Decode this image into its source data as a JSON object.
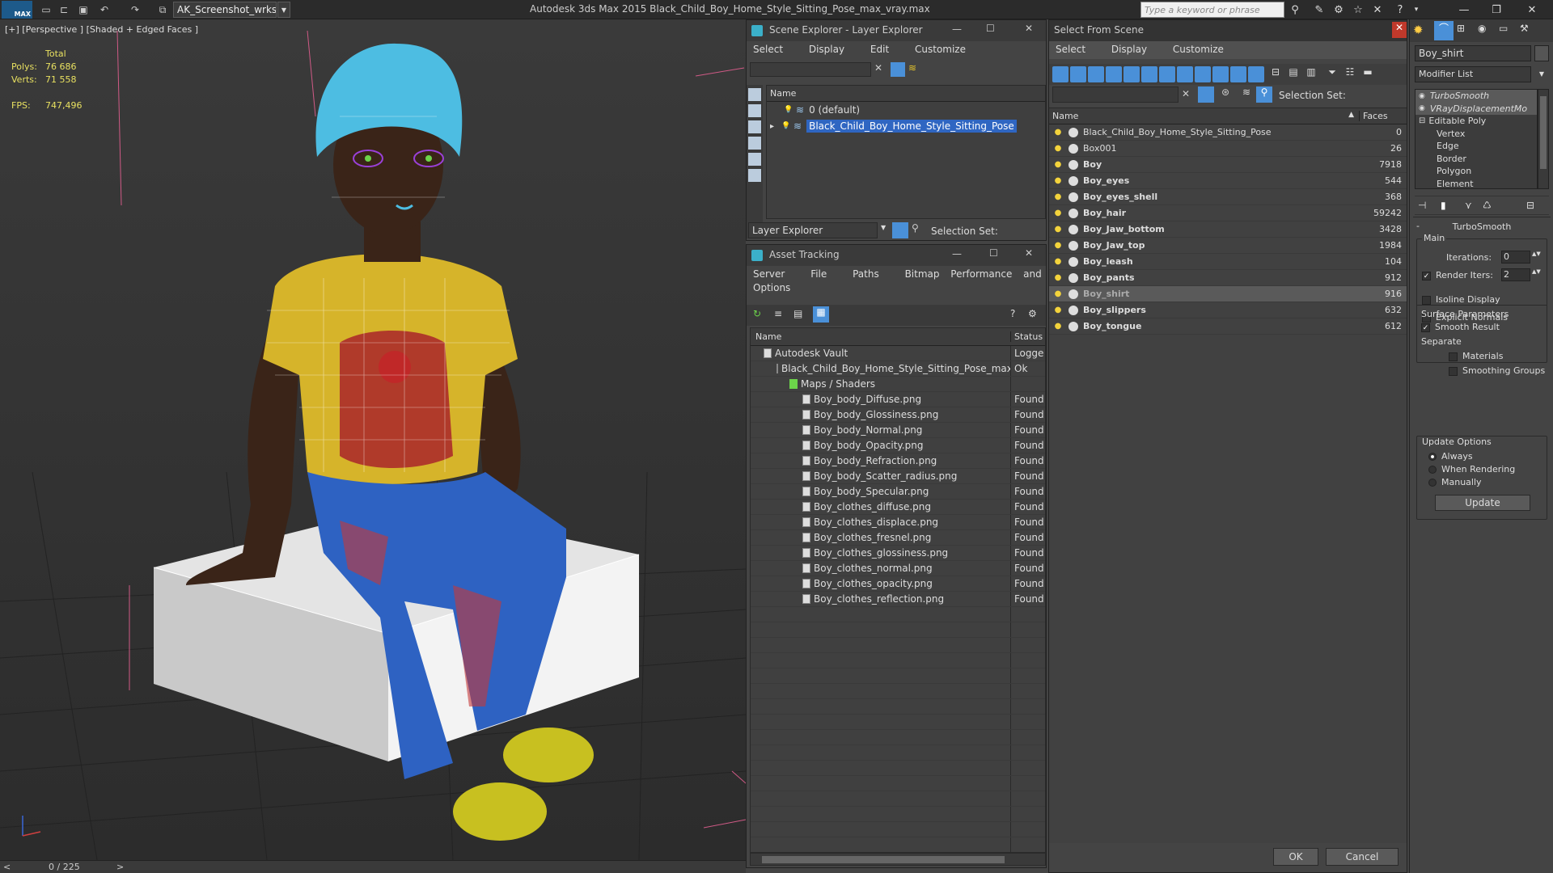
{
  "app": {
    "logo": "MAX",
    "workspace": "AK_Screenshot_wrksp",
    "title": "Autodesk 3ds Max  2015    Black_Child_Boy_Home_Style_Sitting_Pose_max_vray.max",
    "search_placeholder": "Type a keyword or phrase"
  },
  "viewport": {
    "label": "[+] [Perspective ] [Shaded + Edged Faces ]",
    "stats": {
      "total_label": "Total",
      "polys_label": "Polys:",
      "polys_value": "76 686",
      "verts_label": "Verts:",
      "verts_value": "71 558",
      "fps_label": "FPS:",
      "fps_value": "747,496"
    },
    "timebar": "0 / 225",
    "timebar_prev": "<",
    "timebar_next": ">"
  },
  "scene_explorer": {
    "title": "Scene Explorer - Layer Explorer",
    "menu": [
      "Select",
      "Display",
      "Edit",
      "Customize"
    ],
    "column_name": "Name",
    "layers": [
      {
        "name": "0 (default)",
        "selected": false
      },
      {
        "name": "Black_Child_Boy_Home_Style_Sitting_Pose",
        "selected": true
      }
    ],
    "footer_dropdown": "Layer Explorer",
    "selection_set_label": "Selection Set:"
  },
  "asset_tracking": {
    "title": "Asset Tracking",
    "menu": [
      "Server",
      "File",
      "Paths",
      "Bitmap Performance and Memory"
    ],
    "menu2": "Options",
    "col_name": "Name",
    "col_status": "Status",
    "rows": [
      {
        "name": "Autodesk Vault",
        "status": "Logge",
        "indent": 1
      },
      {
        "name": "Black_Child_Boy_Home_Style_Sitting_Pose_max_...",
        "status": "Ok",
        "indent": 2
      },
      {
        "name": "Maps / Shaders",
        "status": "",
        "indent": 3
      },
      {
        "name": "Boy_body_Diffuse.png",
        "status": "Found",
        "indent": 4
      },
      {
        "name": "Boy_body_Glossiness.png",
        "status": "Found",
        "indent": 4
      },
      {
        "name": "Boy_body_Normal.png",
        "status": "Found",
        "indent": 4
      },
      {
        "name": "Boy_body_Opacity.png",
        "status": "Found",
        "indent": 4
      },
      {
        "name": "Boy_body_Refraction.png",
        "status": "Found",
        "indent": 4
      },
      {
        "name": "Boy_body_Scatter_radius.png",
        "status": "Found",
        "indent": 4
      },
      {
        "name": "Boy_body_Specular.png",
        "status": "Found",
        "indent": 4
      },
      {
        "name": "Boy_clothes_diffuse.png",
        "status": "Found",
        "indent": 4
      },
      {
        "name": "Boy_clothes_displace.png",
        "status": "Found",
        "indent": 4
      },
      {
        "name": "Boy_clothes_fresnel.png",
        "status": "Found",
        "indent": 4
      },
      {
        "name": "Boy_clothes_glossiness.png",
        "status": "Found",
        "indent": 4
      },
      {
        "name": "Boy_clothes_normal.png",
        "status": "Found",
        "indent": 4
      },
      {
        "name": "Boy_clothes_opacity.png",
        "status": "Found",
        "indent": 4
      },
      {
        "name": "Boy_clothes_reflection.png",
        "status": "Found",
        "indent": 4
      }
    ]
  },
  "select_from_scene": {
    "title": "Select From Scene",
    "menu": [
      "Select",
      "Display",
      "Customize"
    ],
    "selection_set_label": "Selection Set:",
    "col_name": "Name",
    "col_faces": "Faces",
    "objects": [
      {
        "name": "Black_Child_Boy_Home_Style_Sitting_Pose",
        "faces": "0",
        "bold": false,
        "selected": false
      },
      {
        "name": "Box001",
        "faces": "26",
        "bold": false,
        "selected": false
      },
      {
        "name": "Boy",
        "faces": "7918",
        "bold": true,
        "selected": false
      },
      {
        "name": "Boy_eyes",
        "faces": "544",
        "bold": true,
        "selected": false
      },
      {
        "name": "Boy_eyes_shell",
        "faces": "368",
        "bold": true,
        "selected": false
      },
      {
        "name": "Boy_hair",
        "faces": "59242",
        "bold": true,
        "selected": false
      },
      {
        "name": "Boy_Jaw_bottom",
        "faces": "3428",
        "bold": true,
        "selected": false
      },
      {
        "name": "Boy_Jaw_top",
        "faces": "1984",
        "bold": true,
        "selected": false
      },
      {
        "name": "Boy_leash",
        "faces": "104",
        "bold": true,
        "selected": false
      },
      {
        "name": "Boy_pants",
        "faces": "912",
        "bold": true,
        "selected": false
      },
      {
        "name": "Boy_shirt",
        "faces": "916",
        "bold": true,
        "selected": true
      },
      {
        "name": "Boy_slippers",
        "faces": "632",
        "bold": true,
        "selected": false
      },
      {
        "name": "Boy_tongue",
        "faces": "612",
        "bold": true,
        "selected": false
      }
    ],
    "ok": "OK",
    "cancel": "Cancel"
  },
  "modify_panel": {
    "object_name": "Boy_shirt",
    "modifier_list": "Modifier List",
    "stack": [
      {
        "name": "TurboSmooth",
        "italic": true,
        "indent": 0
      },
      {
        "name": "VRayDisplacementMo",
        "italic": true,
        "indent": 0
      },
      {
        "name": "Editable Poly",
        "italic": false,
        "indent": 0
      },
      {
        "name": "Vertex",
        "italic": false,
        "indent": 1
      },
      {
        "name": "Edge",
        "italic": false,
        "indent": 1
      },
      {
        "name": "Border",
        "italic": false,
        "indent": 1
      },
      {
        "name": "Polygon",
        "italic": false,
        "indent": 1
      },
      {
        "name": "Element",
        "italic": false,
        "indent": 1
      }
    ],
    "rollout_title": "TurboSmooth",
    "main_label": "Main",
    "iterations_label": "Iterations:",
    "iterations_value": "0",
    "render_iters_label": "Render Iters:",
    "render_iters_value": "2",
    "isoline_label": "Isoline Display",
    "explicit_normals_label": "Explicit Normals",
    "surface_params_label": "Surface Parameters",
    "smooth_result_label": "Smooth Result",
    "separate_label": "Separate",
    "materials_label": "Materials",
    "smoothing_groups_label": "Smoothing Groups",
    "update_options_label": "Update Options",
    "always_label": "Always",
    "when_rendering_label": "When Rendering",
    "manually_label": "Manually",
    "update_button": "Update"
  }
}
